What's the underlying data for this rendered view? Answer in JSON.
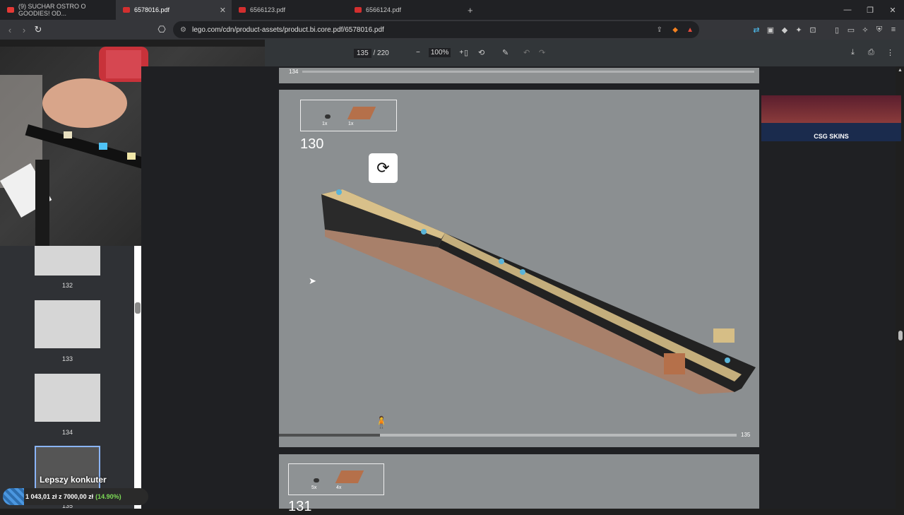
{
  "tabs": [
    {
      "label": "(9) SUCHAR OSTRO O GOODIES! OD...",
      "color": "#e53935",
      "active": false
    },
    {
      "label": "6578016.pdf",
      "color": "#d32f2f",
      "active": true
    },
    {
      "label": "6566123.pdf",
      "color": "#d32f2f",
      "active": false
    },
    {
      "label": "6566124.pdf",
      "color": "#d32f2f",
      "active": false
    }
  ],
  "address": {
    "url": "lego.com/cdn/product-assets/product.bi.core.pdf/6578016.pdf"
  },
  "pdf_toolbar": {
    "current_page": "135",
    "total_pages": "/ 220",
    "zoom": "100%"
  },
  "sidebar": {
    "thumbnails": [
      {
        "label": "132"
      },
      {
        "label": "133"
      },
      {
        "label": "134"
      },
      {
        "label": "135"
      }
    ]
  },
  "document": {
    "prev_page_label": "134",
    "step_current": {
      "number": "130",
      "parts": [
        {
          "qty": "1x"
        },
        {
          "qty": "1x"
        }
      ]
    },
    "page_progress_label": "135",
    "progress_fraction": 0.22,
    "step_next": {
      "number": "131",
      "parts": [
        {
          "qty": "5x"
        },
        {
          "qty": "4x"
        }
      ]
    }
  },
  "ad": {
    "brand": "CSG SKINS"
  },
  "overlay": {
    "name": "Lepszy konkuter",
    "donation_text": "1 043,01 zł z 7000,00 zł",
    "donation_pct": "(14.90%)"
  }
}
